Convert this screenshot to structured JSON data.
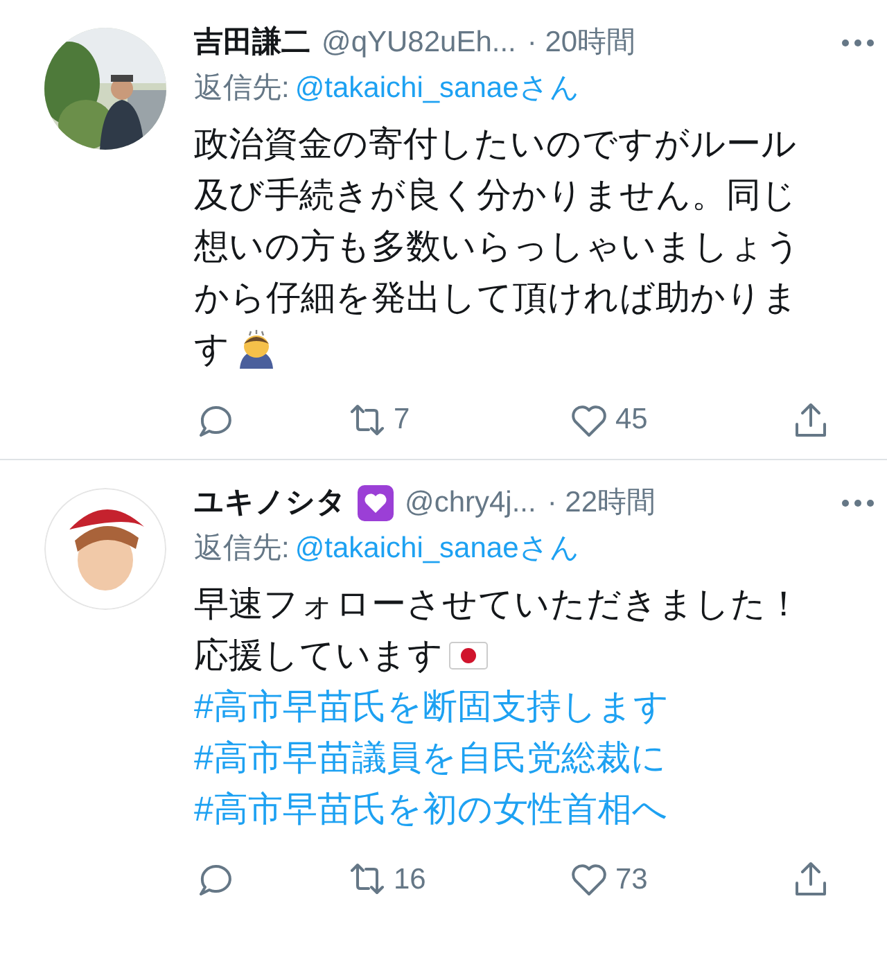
{
  "tweets": [
    {
      "name": "吉田謙二",
      "handle": "@qYU82uEh...",
      "time": "· 20時間",
      "reply_label": "返信先:",
      "reply_to": "@takaichi_sanaeさん",
      "body": [
        {
          "kind": "text",
          "text": "政治資金の寄付したいのですがルール及び手続きが良く分かりません。同じ想いの方も多数いらっしゃいましょうから仔細を発出して頂ければ助かりま"
        },
        {
          "kind": "text",
          "text": "す",
          "emoji": {
            "kind": "bow"
          }
        }
      ],
      "retweets": "7",
      "likes": "45"
    },
    {
      "name": "ユキノシタ",
      "name_emoji": {
        "kind": "heart"
      },
      "handle": "@chry4j...",
      "time": "· 22時間",
      "reply_label": "返信先:",
      "reply_to": "@takaichi_sanaeさん",
      "avatar": {
        "kind": "memoji"
      },
      "body": [
        {
          "kind": "text",
          "text": "早速フォローさせていただきました！"
        },
        {
          "kind": "text",
          "text": "応援しています",
          "emoji": {
            "kind": "flag"
          }
        },
        {
          "kind": "hashtag",
          "text": "#高市早苗氏を断固支持します"
        },
        {
          "kind": "hashtag",
          "text": "#高市早苗議員を自民党総裁に"
        },
        {
          "kind": "hashtag",
          "text": "#高市早苗氏を初の女性首相へ"
        }
      ],
      "retweets": "16",
      "likes": "73"
    }
  ]
}
